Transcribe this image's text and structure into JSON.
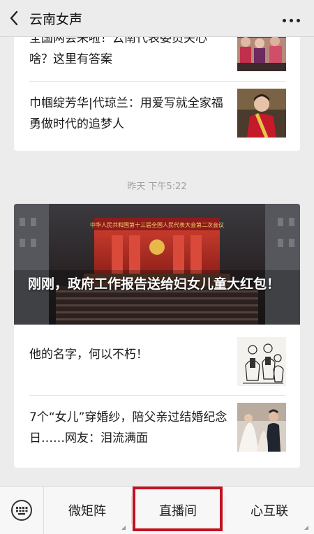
{
  "header": {
    "title": "云南女声"
  },
  "feed": {
    "card1": {
      "items": [
        {
          "title": "全国两会来啦！云南代表委员关心啥？这里有答案"
        },
        {
          "title": "巾帼绽芳华|代琼兰：用爱写就全家福 勇做时代的追梦人"
        }
      ]
    },
    "timestamp": "昨天 下午5:22",
    "card2": {
      "hero_title": "刚刚，政府工作报告送给妇女儿童大红包！",
      "hero_banner": "中华人民共和国第十三届全国人民代表大会第二次会议",
      "items": [
        {
          "title": "他的名字，何以不朽！"
        },
        {
          "title": "7个“女儿”穿婚纱，陪父亲过结婚纪念日……网友：泪流满面"
        }
      ]
    }
  },
  "bottom_menu": {
    "items": [
      {
        "label": "微矩阵"
      },
      {
        "label": "直播间"
      },
      {
        "label": "心互联"
      }
    ],
    "highlight_color": "#c1121f"
  },
  "icons": [
    "back-arrow-icon",
    "more-dots-icon",
    "keyboard-icon"
  ]
}
